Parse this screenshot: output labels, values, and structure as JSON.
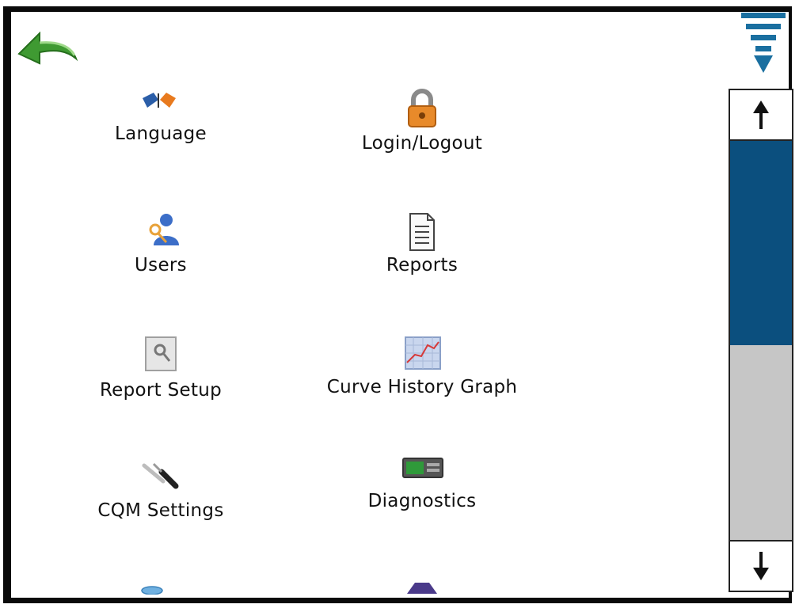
{
  "nav": {
    "back_icon": "back-arrow-icon",
    "menu_icon": "menu-funnel-icon"
  },
  "items": [
    {
      "label": "Language",
      "icon": "flags-icon"
    },
    {
      "label": "Login/Logout",
      "icon": "padlock-icon"
    },
    {
      "label": "Users",
      "icon": "users-icon"
    },
    {
      "label": "Reports",
      "icon": "document-icon"
    },
    {
      "label": "Report Setup",
      "icon": "report-setup-icon"
    },
    {
      "label": "Curve History Graph",
      "icon": "graph-icon"
    },
    {
      "label": "CQM Settings",
      "icon": "wrench-screwdriver-icon"
    },
    {
      "label": "Diagnostics",
      "icon": "diagnostics-icon"
    }
  ],
  "scrollbar": {
    "up_icon": "arrow-up-icon",
    "down_icon": "arrow-down-icon",
    "position": 0.0
  },
  "colors": {
    "accent": "#0b4f7e",
    "track": "#c6c6c6",
    "back_arrow": "#3f9a32"
  }
}
